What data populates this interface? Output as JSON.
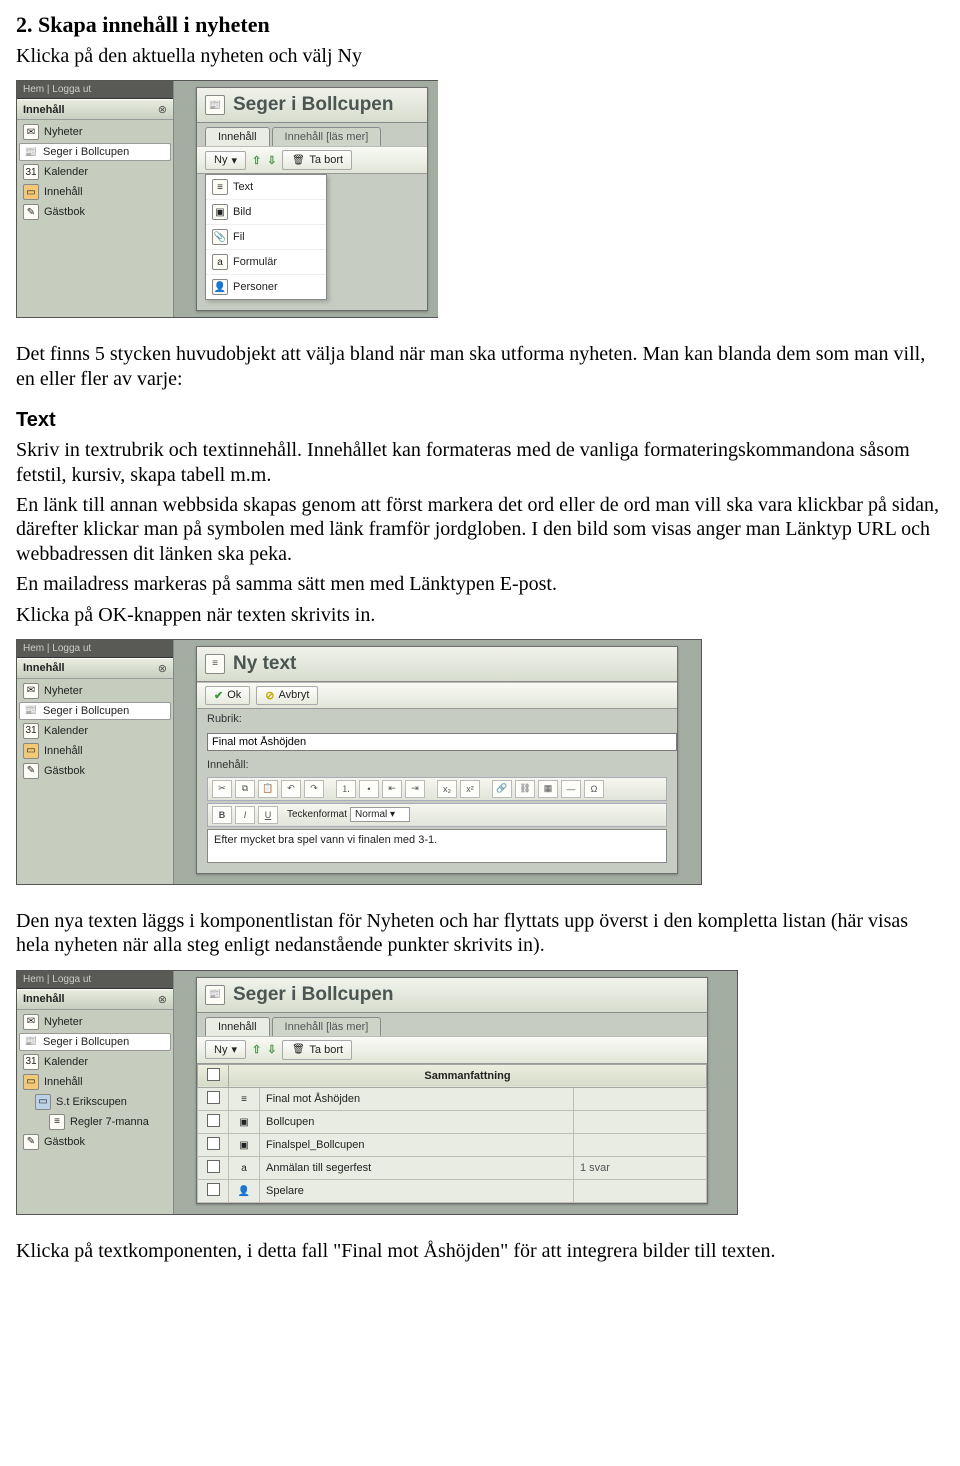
{
  "doc": {
    "heading": "2. Skapa innehåll i nyheten",
    "intro": "Klicka på den aktuella nyheten och välj Ny",
    "p1": "Det finns 5 stycken huvudobjekt att välja bland när man ska utforma nyheten. Man kan blanda dem som man vill, en eller fler av varje:",
    "text_label": "Text",
    "p2": "Skriv in textrubrik och textinnehåll. Innehållet kan formateras med de vanliga formateringskommandona såsom fetstil, kursiv, skapa tabell m.m.",
    "p3": "En länk till annan webbsida skapas genom att först markera det ord eller de ord man vill ska vara klickbar på sidan, därefter klickar man på symbolen med länk framför jordgloben. I den bild som visas anger man Länktyp URL och webbadressen dit länken ska peka.",
    "p4": "En mailadress markeras på samma sätt men med Länktypen E-post.",
    "p5": "Klicka på OK-knappen när texten skrivits in.",
    "p6": "Den nya texten läggs i komponentlistan för Nyheten och har flyttats upp överst i den kompletta listan (här visas hela nyheten när alla steg enligt nedanstående punkter skrivits in).",
    "p7": "Klicka på textkomponenten, i detta fall \"Final mot Åshöjden\" för att integrera bilder till texten."
  },
  "common": {
    "topbar": "Hem | Logga ut",
    "sidebar_header": "Innehåll",
    "nav": {
      "nyheter": "Nyheter",
      "seger": "Seger i Bollcupen",
      "kalender": "Kalender",
      "innehall": "Innehåll",
      "gastbok": "Gästbok",
      "erikscupen": "S.t Erikscupen",
      "regler": "Regler 7-manna"
    }
  },
  "shot1": {
    "title": "Seger i Bollcupen",
    "tab1": "Innehåll",
    "tab2": "Innehåll [läs mer]",
    "btn_ny": "Ny",
    "btn_tabort": "Ta bort",
    "menu": {
      "text": "Text",
      "bild": "Bild",
      "fil": "Fil",
      "formular": "Formulär",
      "personer": "Personer"
    }
  },
  "shot2": {
    "title": "Ny text",
    "btn_ok": "Ok",
    "btn_avbryt": "Avbryt",
    "label_rubrik": "Rubrik:",
    "value_rubrik": "Final mot Åshöjden",
    "label_innehall": "Innehåll:",
    "format_label": "Teckenformat",
    "format_value": "Normal",
    "editor_text": "Efter mycket bra spel vann vi finalen med 3-1."
  },
  "shot3": {
    "title": "Seger i Bollcupen",
    "tab1": "Innehåll",
    "tab2": "Innehåll [läs mer]",
    "btn_ny": "Ny",
    "btn_tabort": "Ta bort",
    "col_summary": "Sammanfattning",
    "rows": [
      {
        "icon": "text",
        "label": "Final mot Åshöjden",
        "extra": ""
      },
      {
        "icon": "image",
        "label": "Bollcupen",
        "extra": ""
      },
      {
        "icon": "image",
        "label": "Finalspel_Bollcupen",
        "extra": ""
      },
      {
        "icon": "form",
        "label": "Anmälan till segerfest",
        "extra": "1 svar"
      },
      {
        "icon": "person",
        "label": "Spelare",
        "extra": ""
      }
    ]
  }
}
